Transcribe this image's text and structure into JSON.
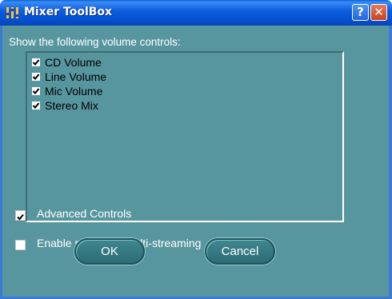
{
  "window": {
    "title": "Mixer ToolBox",
    "icon": "mixer-app-icon",
    "help_label": "?",
    "close_label": "✕"
  },
  "prompt": "Show the following volume controls:",
  "volume_controls": [
    {
      "label": "CD Volume",
      "checked": true
    },
    {
      "label": "Line Volume",
      "checked": true
    },
    {
      "label": "Mic Volume",
      "checked": true
    },
    {
      "label": "Stereo Mix",
      "checked": true
    }
  ],
  "options": {
    "advanced_controls": {
      "label": "Advanced Controls",
      "checked": true
    },
    "multi_streaming": {
      "label": "Enable recording multi-streaming",
      "checked": false
    }
  },
  "buttons": {
    "ok": "OK",
    "cancel": "Cancel"
  },
  "colors": {
    "titlebar": "#0553d4",
    "client": "#58969f",
    "button": "#2c6c75"
  }
}
